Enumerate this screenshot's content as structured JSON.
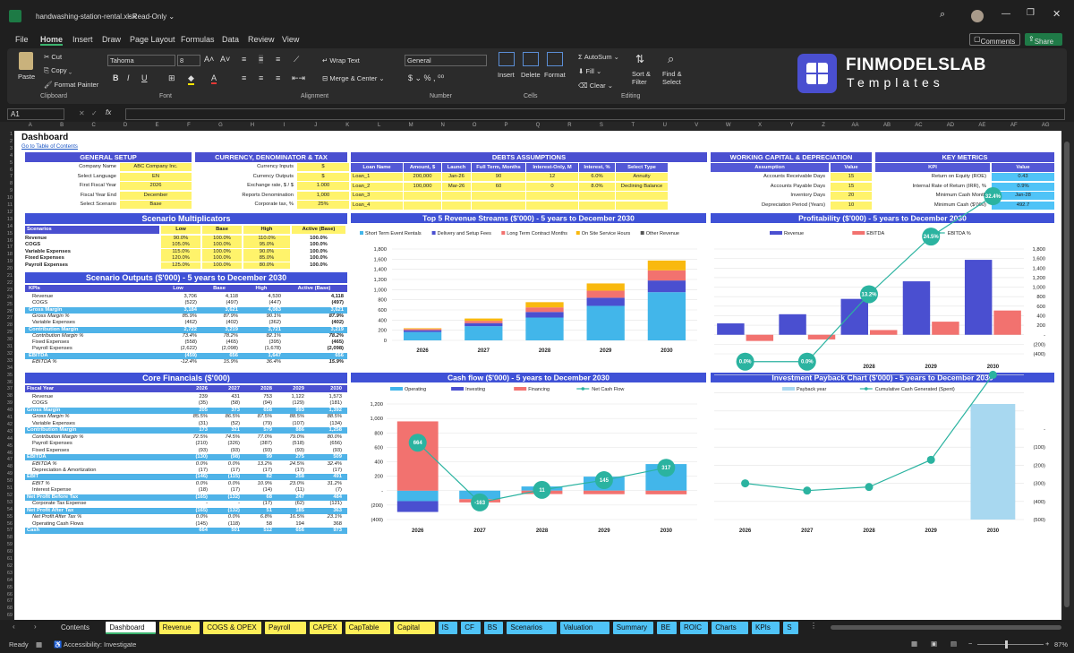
{
  "window": {
    "filename": "handwashing-station-rental.xlsx",
    "readonly": "Read-Only"
  },
  "menu": [
    "File",
    "Home",
    "Insert",
    "Draw",
    "Page Layout",
    "Formulas",
    "Data",
    "Review",
    "View"
  ],
  "actions": {
    "comments": "Comments",
    "share": "Share"
  },
  "ribbon": {
    "paste": "Paste",
    "cut": "Cut",
    "copy": "Copy",
    "format_painter": "Format Painter",
    "clipboard": "Clipboard",
    "font_name": "Tahoma",
    "font_size": "8",
    "font": "Font",
    "wrap": "Wrap Text",
    "merge": "Merge & Center",
    "alignment": "Alignment",
    "number_format": "General",
    "number": "Number",
    "insert": "Insert",
    "delete": "Delete",
    "format": "Format",
    "cells": "Cells",
    "autosum": "AutoSum",
    "fill": "Fill",
    "clear": "Clear",
    "sort": "Sort & Filter",
    "find": "Find & Select",
    "editing": "Editing"
  },
  "brand": {
    "name": "FINMODELSLAB",
    "sub": "Templates"
  },
  "formula": {
    "cell": "A1",
    "fx": "fx"
  },
  "columns": [
    "A",
    "B",
    "C",
    "D",
    "E",
    "F",
    "G",
    "H",
    "I",
    "J",
    "K",
    "L",
    "M",
    "N",
    "O",
    "P",
    "Q",
    "R",
    "S",
    "T",
    "U",
    "V",
    "W",
    "X",
    "Y",
    "Z",
    "AA",
    "AB",
    "AC",
    "AD",
    "AE",
    "AF",
    "AG"
  ],
  "dashboard": {
    "title": "Dashboard",
    "link": "Go to Table of Contents"
  },
  "general": {
    "title": "GENERAL SETUP",
    "rows": [
      [
        "Company Name",
        "ABC Company Inc."
      ],
      [
        "Select Language",
        "EN"
      ],
      [
        "First Fiscal Year",
        "2026"
      ],
      [
        "Fiscal Year End",
        "December"
      ],
      [
        "Select Scenario",
        "Base"
      ]
    ]
  },
  "currency": {
    "title": "CURRENCY, DENOMINATOR & TAX",
    "rows": [
      [
        "Currency Inputs",
        "$"
      ],
      [
        "Currency Outputs",
        "$"
      ],
      [
        "Exchange rate, $ / $",
        "1.000"
      ],
      [
        "Reports Denomination",
        "1,000"
      ],
      [
        "Corporate tax, %",
        "25%"
      ]
    ]
  },
  "debts": {
    "title": "DEBTS ASSUMPTIONS",
    "headers": [
      "Loan Name",
      "Amount, $",
      "Launch",
      "Full Term, Months",
      "Interest-Only, M",
      "Interest, %",
      "Select Type"
    ],
    "rows": [
      [
        "Loan_1",
        "200,000",
        "Jan-26",
        "90",
        "12",
        "6.0%",
        "Annuity"
      ],
      [
        "Loan_2",
        "100,000",
        "Mar-26",
        "60",
        "0",
        "8.0%",
        "Declining Balance"
      ],
      [
        "Loan_3",
        "",
        "",
        "",
        "",
        "",
        ""
      ],
      [
        "Loan_4",
        "",
        "",
        "",
        "",
        "",
        ""
      ]
    ]
  },
  "wc": {
    "title": "WORKING CAPITAL & DEPRECIATION",
    "headers": [
      "Assumption",
      "Value"
    ],
    "rows": [
      [
        "Accounts Receivable Days",
        "15"
      ],
      [
        "Accounts Payable Days",
        "15"
      ],
      [
        "Inventory Days",
        "20"
      ],
      [
        "Depreciation Period (Years)",
        "10"
      ]
    ]
  },
  "km": {
    "title": "KEY METRICS",
    "headers": [
      "KPI",
      "Value"
    ],
    "rows": [
      [
        "Return on Equity (ROE)",
        "0.43"
      ],
      [
        "Internal Rate of Return (IRR), %",
        "0.9%"
      ],
      [
        "Minimum Cash Month",
        "Jan-28"
      ],
      [
        "Minimum Cash ($'000)",
        "492.7"
      ]
    ]
  },
  "scenario": {
    "title": "Scenario Multiplicators",
    "headers": [
      "Scenarios",
      "Low",
      "Base",
      "High",
      "Active (Base)"
    ],
    "rows": [
      [
        "Revenue",
        "90.0%",
        "100.0%",
        "110.0%",
        "100.0%"
      ],
      [
        "COGS",
        "105.0%",
        "100.0%",
        "95.0%",
        "100.0%"
      ],
      [
        "Variable Expenses",
        "115.0%",
        "100.0%",
        "90.0%",
        "100.0%"
      ],
      [
        "Fixed Expenses",
        "120.0%",
        "100.0%",
        "85.0%",
        "100.0%"
      ],
      [
        "Payroll Expenses",
        "125.0%",
        "100.0%",
        "80.0%",
        "100.0%"
      ]
    ]
  },
  "outputs": {
    "title": "Scenario Outputs ($'000) - 5 years to December 2030",
    "headers": [
      "KPIs",
      "Low",
      "Base",
      "High",
      "Active (Base)"
    ],
    "rows": [
      [
        "Revenue",
        "3,706",
        "4,118",
        "4,530",
        "4,118"
      ],
      [
        "COGS",
        "(522)",
        "(497)",
        "(447)",
        "(497)"
      ],
      [
        "Gross Margin",
        "3,184",
        "3,621",
        "4,083",
        "3,621"
      ],
      [
        "Gross Margin %",
        "85.9%",
        "87.9%",
        "90.1%",
        "87.9%"
      ],
      [
        "Variable Expenses",
        "(462)",
        "(402)",
        "(362)",
        "(402)"
      ],
      [
        "Contribution Margin",
        "2,722",
        "3,219",
        "3,721",
        "3,219"
      ],
      [
        "Contribution Margin %",
        "73.4%",
        "78.2%",
        "82.1%",
        "78.2%"
      ],
      [
        "Fixed Expenses",
        "(558)",
        "(465)",
        "(395)",
        "(465)"
      ],
      [
        "Payroll Expenses",
        "(2,622)",
        "(2,098)",
        "(1,678)",
        "(2,098)"
      ],
      [
        "EBITDA",
        "(459)",
        "656",
        "1,647",
        "656"
      ],
      [
        "EBITDA %",
        "-12.4%",
        "15.9%",
        "36.4%",
        "15.9%"
      ]
    ]
  },
  "core": {
    "title": "Core Financials ($'000)",
    "headers": [
      "Fiscal Year",
      "2026",
      "2027",
      "2028",
      "2029",
      "2030"
    ],
    "rows": [
      [
        "Revenue",
        "239",
        "431",
        "753",
        "1,122",
        "1,573"
      ],
      [
        "COGS",
        "(35)",
        "(58)",
        "(94)",
        "(129)",
        "(181)"
      ],
      [
        "Gross Margin",
        "205",
        "373",
        "658",
        "993",
        "1,392"
      ],
      [
        "Gross Margin %",
        "85.5%",
        "86.5%",
        "87.5%",
        "88.5%",
        "88.5%"
      ],
      [
        "Variable Expenses",
        "(31)",
        "(52)",
        "(79)",
        "(107)",
        "(134)"
      ],
      [
        "Contribution Margin",
        "173",
        "321",
        "579",
        "886",
        "1,258"
      ],
      [
        "Contribution Margin %",
        "72.5%",
        "74.5%",
        "77.0%",
        "79.0%",
        "80.0%"
      ],
      [
        "Payroll Expenses",
        "(210)",
        "(326)",
        "(387)",
        "(518)",
        "(656)"
      ],
      [
        "Fixed Expenses",
        "(93)",
        "(93)",
        "(93)",
        "(93)",
        "(93)"
      ],
      [
        "EBITDA",
        "(130)",
        "(98)",
        "99",
        "275",
        "509"
      ],
      [
        "EBITDA %",
        "0.0%",
        "0.0%",
        "13.2%",
        "24.5%",
        "32.4%"
      ],
      [
        "Depreciation & Amortization",
        "(17)",
        "(17)",
        "(17)",
        "(17)",
        "(17)"
      ],
      [
        "EBIT",
        "(146)",
        "(115)",
        "82",
        "258",
        "491"
      ],
      [
        "EBIT %",
        "0.0%",
        "0.0%",
        "10.9%",
        "23.0%",
        "31.2%"
      ],
      [
        "Interest Expense",
        "(18)",
        "(17)",
        "(14)",
        "(11)",
        "(7)"
      ],
      [
        "Net Profit Before Tax",
        "(165)",
        "(132)",
        "68",
        "247",
        "484"
      ],
      [
        "Corporate Tax Expense",
        "-",
        "-",
        "(17)",
        "(62)",
        "(121)"
      ],
      [
        "Net Profit After Tax",
        "(165)",
        "(132)",
        "51",
        "185",
        "363"
      ],
      [
        "Net Profit After Tax %",
        "0.0%",
        "0.0%",
        "6.8%",
        "16.5%",
        "23.1%"
      ],
      [
        "Operating Cash Flows",
        "(145)",
        "(118)",
        "58",
        "194",
        "368"
      ],
      [
        "Cash",
        "664",
        "501",
        "512",
        "656",
        "973"
      ]
    ]
  },
  "chart_data": [
    {
      "type": "bar",
      "title": "Top 5 Revenue Streams ($'000) - 5 years to December 2030",
      "categories": [
        "2026",
        "2027",
        "2028",
        "2029",
        "2030"
      ],
      "ylim": [
        0,
        1800
      ],
      "series": [
        {
          "name": "Short Term Event Rentals",
          "values": [
            165,
            280,
            450,
            680,
            950
          ],
          "color": "#42b6ea"
        },
        {
          "name": "Delivery and Setup Fees",
          "values": [
            35,
            60,
            110,
            160,
            230
          ],
          "color": "#4a4fd0"
        },
        {
          "name": "Long Term Contract Months",
          "values": [
            25,
            45,
            90,
            140,
            200
          ],
          "color": "#f2726f"
        },
        {
          "name": "On Site Service Hours",
          "values": [
            14,
            46,
            103,
            142,
            193
          ],
          "color": "#f9b90f"
        },
        {
          "name": "Other Revenue",
          "values": [
            0,
            0,
            0,
            0,
            0
          ],
          "color": "#555555"
        }
      ]
    },
    {
      "type": "bar",
      "title": "Profitability ($'000) - 5 years to December 2030",
      "categories": [
        "2026",
        "2027",
        "2028",
        "2029",
        "2030"
      ],
      "yleft": [
        -400,
        1800
      ],
      "yright": [
        "1,800",
        "1,600",
        "1,400",
        "1,200",
        "1,000",
        "800",
        "600",
        "400",
        "200",
        "-",
        "(200)",
        "(400)"
      ],
      "series": [
        {
          "name": "Revenue",
          "values": [
            239,
            431,
            753,
            1122,
            1573
          ],
          "color": "#4a4fd0"
        },
        {
          "name": "EBITDA",
          "values": [
            -130,
            -98,
            99,
            275,
            509
          ],
          "color": "#f2726f"
        },
        {
          "name": "EBITDA %",
          "values": [
            "0.0%",
            "0.0%",
            "13.2%",
            "24.5%",
            "32.4%"
          ],
          "color": "#2bb3a0"
        }
      ]
    },
    {
      "type": "bar",
      "title": "Cash flow ($'000) - 5 years to December 2030",
      "categories": [
        "2026",
        "2027",
        "2028",
        "2029",
        "2030"
      ],
      "ylim": [
        -400,
        1200
      ],
      "series": [
        {
          "name": "Operating",
          "values": [
            -145,
            -118,
            58,
            194,
            368
          ],
          "color": "#42b6ea"
        },
        {
          "name": "Investing",
          "values": [
            -150,
            0,
            0,
            0,
            0
          ],
          "color": "#4a4fd0"
        },
        {
          "name": "Financing",
          "values": [
            959,
            -45,
            -47,
            -49,
            -51
          ],
          "color": "#f2726f"
        },
        {
          "name": "Net Cash Flow",
          "values": [
            664,
            -163,
            11,
            145,
            317
          ],
          "color": "#2bb3a0"
        }
      ]
    },
    {
      "type": "line",
      "title": "Investment Payback Chart ($'000) - 5 years to December 2030",
      "categories": [
        "2026",
        "2027",
        "2028",
        "2029",
        "2030"
      ],
      "yright": [
        "-",
        "(100)",
        "(200)",
        "(300)",
        "(400)",
        "(500)"
      ],
      "series": [
        {
          "name": "Payback year",
          "values": [
            0,
            0,
            0,
            0,
            1
          ],
          "color": "#a8d8f0"
        },
        {
          "name": "Cumulative Cash Generated (Spent)",
          "values": [
            -300,
            -340,
            -320,
            -170,
            300
          ],
          "color": "#2bb3a0"
        }
      ]
    }
  ],
  "sheet_tabs": [
    [
      "Contents",
      "#1f1f1f"
    ],
    [
      "Dashboard",
      "#ffffff"
    ],
    [
      "Revenue",
      "#ffee58"
    ],
    [
      "COGS & OPEX",
      "#ffee58"
    ],
    [
      "Payroll",
      "#ffee58"
    ],
    [
      "CAPEX",
      "#ffee58"
    ],
    [
      "CapTable",
      "#ffee58"
    ],
    [
      "Capital",
      "#ffee58"
    ],
    [
      "IS",
      "#4fc3f7"
    ],
    [
      "CF",
      "#4fc3f7"
    ],
    [
      "BS",
      "#4fc3f7"
    ],
    [
      "Scenarios",
      "#4fc3f7"
    ],
    [
      "Valuation",
      "#4fc3f7"
    ],
    [
      "Summary",
      "#4fc3f7"
    ],
    [
      "BE",
      "#4fc3f7"
    ],
    [
      "ROIC",
      "#4fc3f7"
    ],
    [
      "Charts",
      "#4fc3f7"
    ],
    [
      "KPIs",
      "#4fc3f7"
    ],
    [
      "S",
      "#4fc3f7"
    ]
  ],
  "statusbar": {
    "ready": "Ready",
    "accessibility": "Accessibility: Investigate",
    "zoom": "87%"
  }
}
